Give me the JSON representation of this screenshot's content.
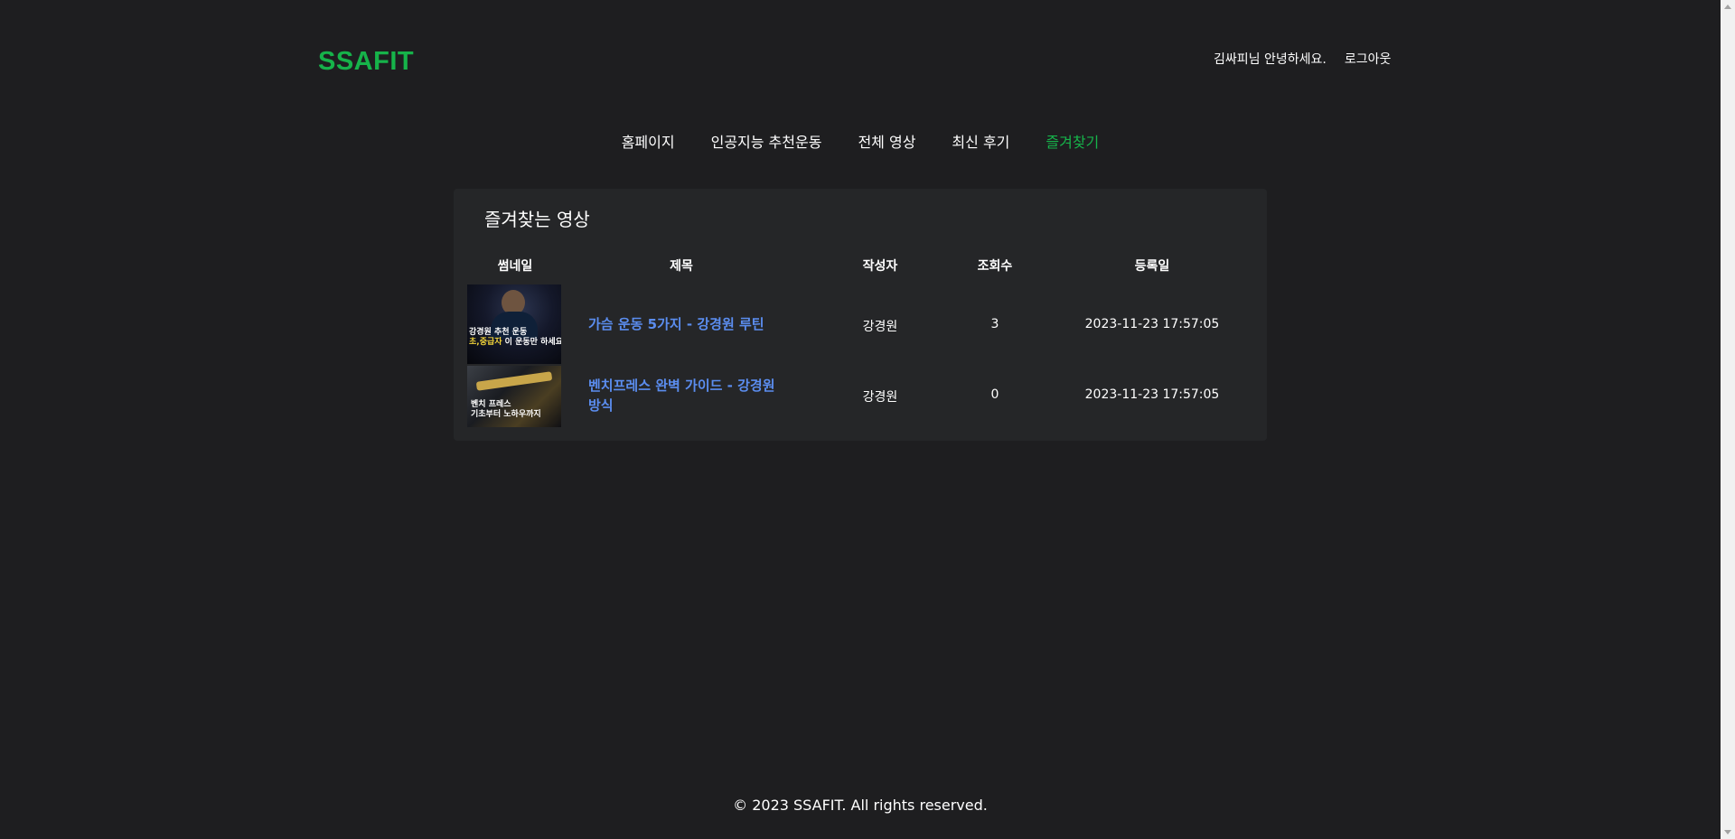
{
  "header": {
    "logo": "SSAFIT",
    "greeting": "김싸피님 안녕하세요.",
    "logout": "로그아웃"
  },
  "nav": {
    "items": [
      {
        "label": "홈페이지",
        "active": false
      },
      {
        "label": "인공지능 추천운동",
        "active": false
      },
      {
        "label": "전체 영상",
        "active": false
      },
      {
        "label": "최신 후기",
        "active": false
      },
      {
        "label": "즐겨찾기",
        "active": true
      }
    ]
  },
  "favorites": {
    "title": "즐겨찾는 영상",
    "columns": {
      "thumbnail": "썸네일",
      "title": "제목",
      "author": "작성자",
      "views": "조회수",
      "date": "등록일"
    },
    "rows": [
      {
        "title": "가슴 운동 5가지 - 강경원 루틴",
        "author": "강경원",
        "views": "3",
        "date": "2023-11-23 17:57:05",
        "thumb_caption_1": "강경원 추천 운동",
        "thumb_caption_2a": "초,중급자",
        "thumb_caption_2b": " 이 운동만 하세요"
      },
      {
        "title": "벤치프레스 완벽 가이드 - 강경원 방식",
        "author": "강경원",
        "views": "0",
        "date": "2023-11-23 17:57:05",
        "thumb_caption_1": "벤치 프레스",
        "thumb_caption_2": "기초부터 노하우까지"
      }
    ]
  },
  "footer": {
    "text": "© 2023 SSAFIT. All rights reserved."
  },
  "colors": {
    "background": "#1e1e20",
    "card": "#252628",
    "accent": "#16b34a",
    "link": "#5b8def"
  }
}
